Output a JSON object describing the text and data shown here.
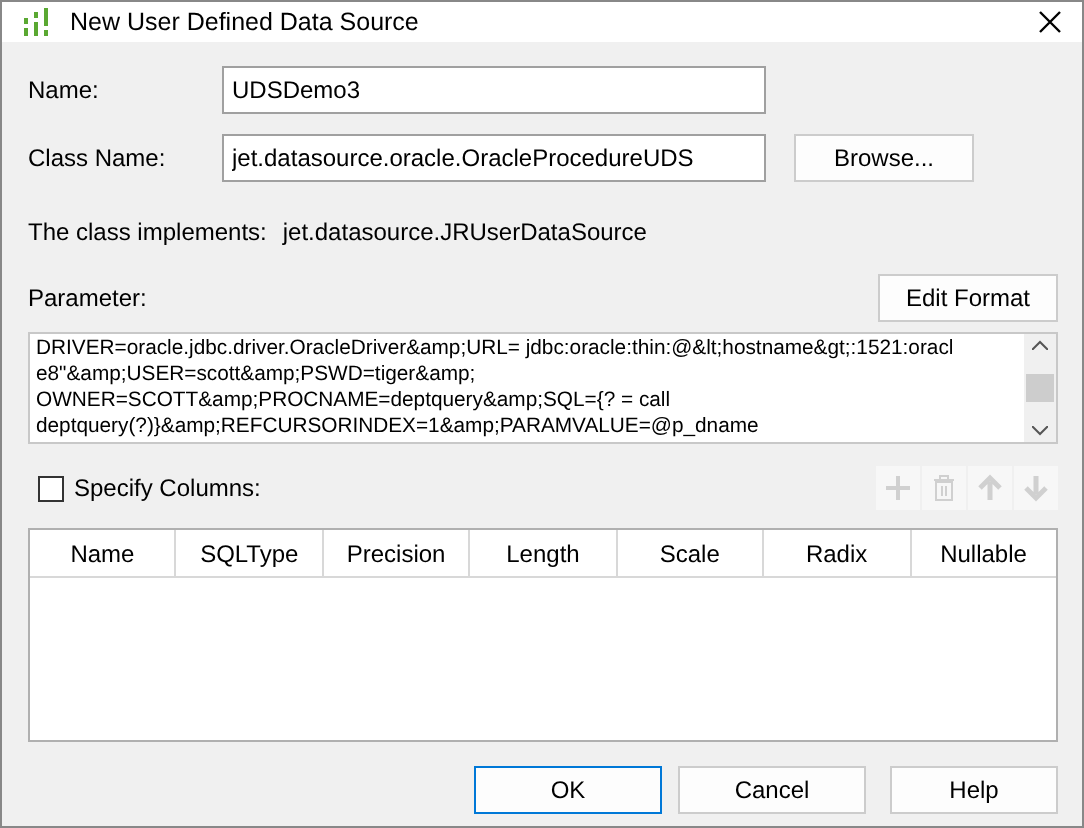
{
  "window": {
    "title": "New User Defined Data Source"
  },
  "fields": [
    {
      "label": "Name:",
      "value": "UDSDemo3"
    },
    {
      "label": "Class Name:",
      "value": "jet.datasource.oracle.OracleProcedureUDS",
      "button": "Browse..."
    }
  ],
  "implements": {
    "label": "The class implements:",
    "value": "jet.datasource.JRUserDataSource"
  },
  "parameter": {
    "label": "Parameter:",
    "button": "Edit Format",
    "lines": [
      "DRIVER=oracle.jdbc.driver.OracleDriver&amp;URL= jdbc:oracle:thin:@&lt;hostname&gt;:1521:oracl",
      "e8\"&amp;USER=scott&amp;PSWD=tiger&amp;",
      "OWNER=SCOTT&amp;PROCNAME=deptquery&amp;SQL={? = call",
      "deptquery(?)}&amp;REFCURSORINDEX=1&amp;PARAMVALUE=@p_dname"
    ]
  },
  "specify_columns": {
    "label": "Specify Columns:",
    "checked": false
  },
  "column_tools": [
    {
      "kind": "add",
      "disabled": true
    },
    {
      "kind": "delete",
      "disabled": true
    },
    {
      "kind": "up",
      "disabled": true
    },
    {
      "kind": "down",
      "disabled": true
    }
  ],
  "table": {
    "columns": [
      "Name",
      "SQLType",
      "Precision",
      "Length",
      "Scale",
      "Radix",
      "Nullable"
    ]
  },
  "buttons": [
    {
      "label": "OK",
      "default": true
    },
    {
      "label": "Cancel",
      "default": false
    },
    {
      "label": "Help",
      "default": false
    }
  ]
}
